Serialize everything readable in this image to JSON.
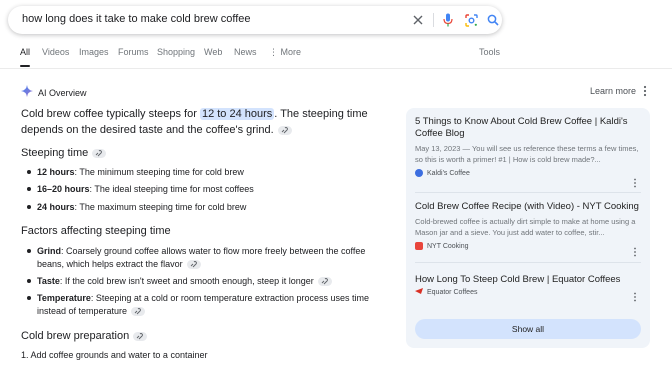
{
  "search": {
    "query": "how long does it take to make cold brew coffee",
    "icons": [
      "clear-icon",
      "microphone-icon",
      "lens-icon",
      "search-icon"
    ]
  },
  "tabs": [
    {
      "label": "All",
      "active": true
    },
    {
      "label": "Videos"
    },
    {
      "label": "Images"
    },
    {
      "label": "Forums"
    },
    {
      "label": "Shopping"
    },
    {
      "label": "Web"
    },
    {
      "label": "News"
    },
    {
      "label": "More"
    },
    {
      "label": "Tools"
    }
  ],
  "ai_overview": {
    "title": "AI Overview",
    "learn_more": "Learn more",
    "intro_pre": "Cold brew coffee typically steeps for ",
    "intro_highlight": "12 to 24 hours",
    "intro_post": ". The steeping time depends on the desired taste and the coffee's grind.",
    "sections": {
      "steeping_time": {
        "heading": "Steeping time",
        "items": [
          {
            "term": "12 hours",
            "text": ": The minimum steeping time for cold brew"
          },
          {
            "term": "16–20 hours",
            "text": ": The ideal steeping time for most coffees"
          },
          {
            "term": "24 hours",
            "text": ": The maximum steeping time for cold brew"
          }
        ]
      },
      "factors": {
        "heading": "Factors affecting steeping time",
        "items": [
          {
            "term": "Grind",
            "line1": ": Coarsely ground coffee allows water to flow more freely between the coffee",
            "line2": "beans, which helps extract the flavor"
          },
          {
            "term": "Taste",
            "line1": ": If the cold brew isn't sweet and smooth enough, steep it longer",
            "line2": ""
          },
          {
            "term": "Temperature",
            "line1": ": Steeping at a cold or room temperature extraction process uses time",
            "line2": "instead of temperature"
          }
        ]
      },
      "preparation": {
        "heading": "Cold brew preparation",
        "steps": [
          "1.  Add coffee grounds and water to a container"
        ]
      }
    },
    "accent_color": "#d3e3fd"
  },
  "sources": {
    "items": [
      {
        "title": "5 Things to Know About Cold Brew Coffee | Kaldi's Coffee Blog",
        "snippet": "May 13, 2023 — You will see us reference these terms a few times, so this is worth a primer! #1 | How is cold brew made?...",
        "site": "Kaldi's Coffee",
        "favicon_color": "#3c6ee0"
      },
      {
        "title": "Cold Brew Coffee Recipe (with Video) - NYT Cooking",
        "snippet": "Cold-brewed coffee is actually dirt simple to make at home using a Mason jar and a sieve. You just add water to coffee, stir...",
        "site": "NYT Cooking",
        "favicon_color": "#e8453c"
      },
      {
        "title": "How Long To Steep Cold Brew | Equator Coffees",
        "snippet": "",
        "site": "Equator Coffees",
        "favicon_color": "#d93025"
      }
    ],
    "show_all": "Show all"
  }
}
